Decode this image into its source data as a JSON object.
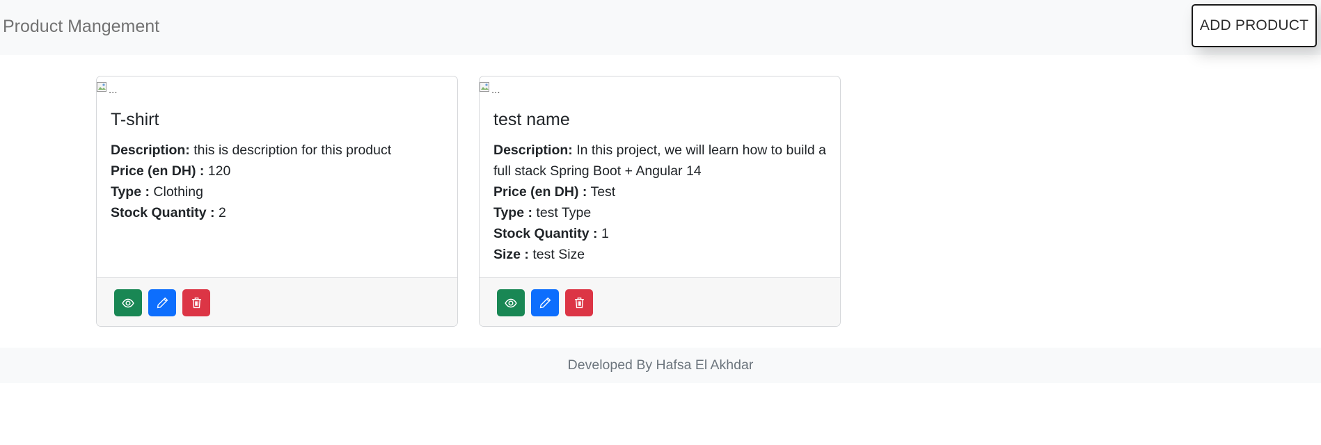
{
  "navbar": {
    "brand": "Product Mangement",
    "add_button_label": "ADD PRODUCT"
  },
  "labels": {
    "description": "Description:",
    "price": "Price (en DH) :",
    "type": "Type :",
    "stock": "Stock Quantity :",
    "size": "Size :"
  },
  "image_alt": "...",
  "products": [
    {
      "name": "T-shirt",
      "description": "this is description for this product",
      "price": "120",
      "type": "Clothing",
      "stock": "2"
    },
    {
      "name": "test name",
      "description": "In this project, we will learn how to build a full stack Spring Boot + Angular 14",
      "price": "Test",
      "type": "test Type",
      "stock": "1",
      "size": "test Size"
    }
  ],
  "actions": {
    "view_icon": "eye-icon",
    "edit_icon": "pencil-icon",
    "delete_icon": "trash-icon",
    "view_color": "#198754",
    "edit_color": "#0d6efd",
    "delete_color": "#dc3545"
  },
  "footer": {
    "text": "Developed By Hafsa El Akhdar"
  }
}
